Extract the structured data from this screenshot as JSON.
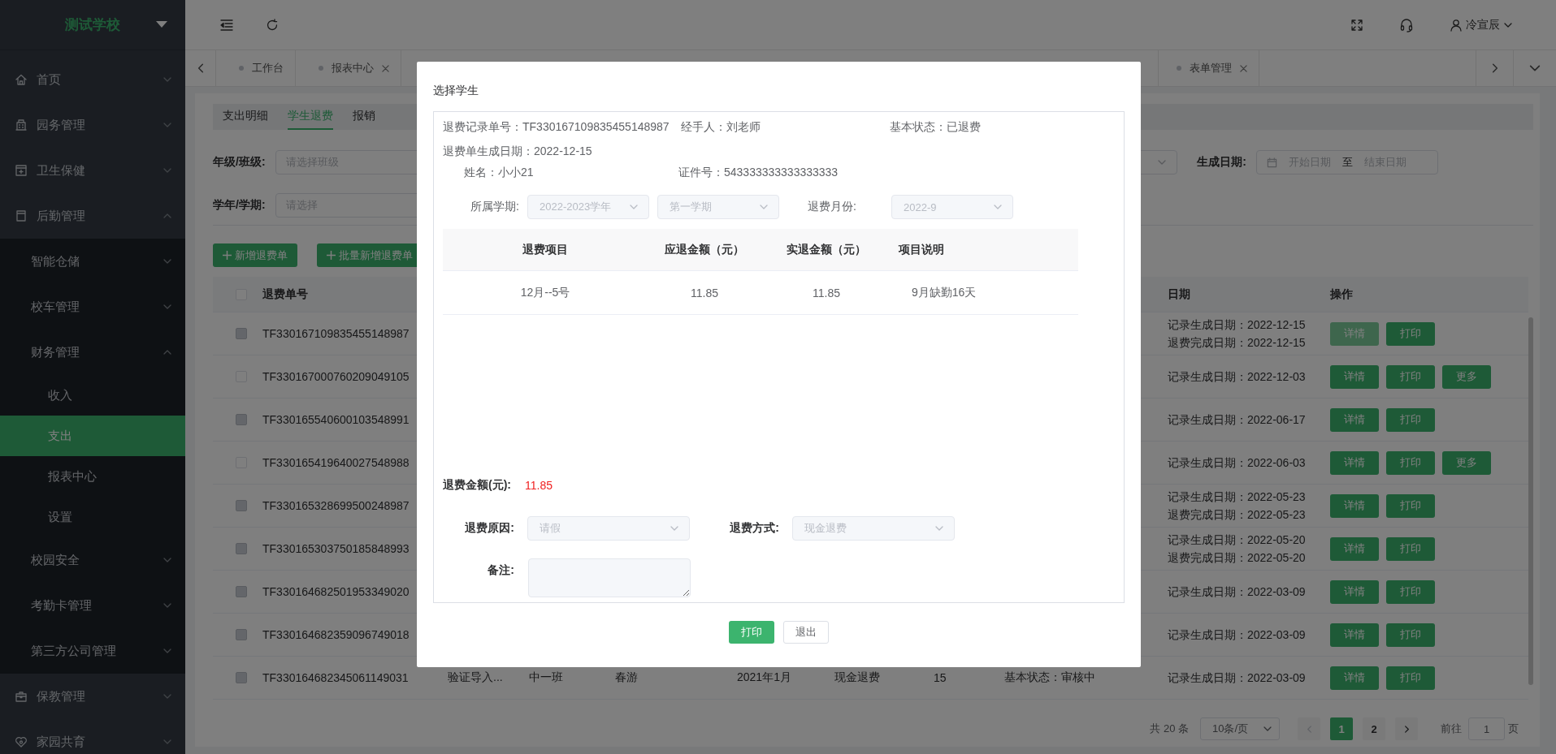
{
  "sidebar": {
    "logo": "测试学校",
    "items": [
      {
        "label": "首页",
        "expanded": false
      },
      {
        "label": "园务管理",
        "expanded": false
      },
      {
        "label": "卫生保健",
        "expanded": false
      },
      {
        "label": "后勤管理",
        "expanded": true,
        "children": [
          {
            "label": "智能仓储",
            "expanded": false
          },
          {
            "label": "校车管理",
            "expanded": false
          },
          {
            "label": "财务管理",
            "expanded": true,
            "children": [
              {
                "label": "收入",
                "selected": false
              },
              {
                "label": "支出",
                "selected": true
              },
              {
                "label": "报表中心",
                "selected": false
              },
              {
                "label": "设置",
                "selected": false
              }
            ]
          },
          {
            "label": "校园安全",
            "expanded": false
          },
          {
            "label": "考勤卡管理",
            "expanded": false
          },
          {
            "label": "第三方公司管理",
            "expanded": false
          }
        ]
      },
      {
        "label": "保教管理",
        "expanded": false
      },
      {
        "label": "家园共育",
        "expanded": false
      }
    ]
  },
  "header": {
    "user": "冷宣辰"
  },
  "page_tabs": [
    {
      "label": "工作台",
      "closable": false
    },
    {
      "label": "报表中心",
      "closable": true
    },
    {
      "label": "表单管理",
      "closable": true
    }
  ],
  "inner_tabs": [
    {
      "label": "支出明细",
      "selected": false
    },
    {
      "label": "学生退费",
      "selected": true
    },
    {
      "label": "报销",
      "selected": false
    }
  ],
  "filters": [
    {
      "label": "年级/班级:",
      "placeholder": "请选择班级"
    },
    {
      "label": "学年/学期:",
      "placeholder": "请选择"
    }
  ],
  "date_filter": {
    "label": "生成日期:",
    "start_placeholder": "开始日期",
    "separator": "至",
    "end_placeholder": "结束日期"
  },
  "actions": [
    "新增退费单",
    "批量新增退费单"
  ],
  "table": {
    "select_all": {
      "checked": false
    },
    "columns": [
      "退费单号",
      "日期",
      "操作"
    ],
    "rows": [
      {
        "disabled": true,
        "number": "TF330167109835455148987",
        "dates": [
          "记录生成日期：2022-12-15",
          "退费完成日期：2022-12-15"
        ],
        "actions": [
          {
            "label": "详情",
            "focused": true
          },
          {
            "label": "打印",
            "focused": false
          }
        ]
      },
      {
        "disabled": false,
        "number": "TF330167000760209049105",
        "dates": [
          "记录生成日期：2022-12-03"
        ],
        "actions": [
          {
            "label": "详情",
            "focused": false
          },
          {
            "label": "打印",
            "focused": false
          },
          {
            "label": "更多",
            "focused": false
          }
        ]
      },
      {
        "disabled": true,
        "number": "TF330165540600103548991",
        "dates": [
          "记录生成日期：2022-06-17"
        ],
        "actions": [
          {
            "label": "详情",
            "focused": false
          },
          {
            "label": "打印",
            "focused": false
          }
        ]
      },
      {
        "disabled": false,
        "number": "TF330165419640027548988",
        "dates": [
          "记录生成日期：2022-06-03"
        ],
        "actions": [
          {
            "label": "详情",
            "focused": false
          },
          {
            "label": "打印",
            "focused": false
          },
          {
            "label": "更多",
            "focused": false
          }
        ]
      },
      {
        "disabled": true,
        "number": "TF330165328699500248987",
        "dates": [
          "记录生成日期：2022-05-23",
          "退费完成日期：2022-05-23"
        ],
        "actions": [
          {
            "label": "详情",
            "focused": false
          },
          {
            "label": "打印",
            "focused": false
          }
        ]
      },
      {
        "disabled": true,
        "number": "TF330165303750185848993",
        "dates": [
          "记录生成日期：2022-05-20",
          "退费完成日期：2022-05-20"
        ],
        "actions": [
          {
            "label": "详情",
            "focused": false
          },
          {
            "label": "打印",
            "focused": false
          }
        ]
      },
      {
        "disabled": true,
        "number": "TF330164682501953349020",
        "dates": [
          "记录生成日期：2022-03-09"
        ],
        "actions": [
          {
            "label": "详情",
            "focused": false
          },
          {
            "label": "打印",
            "focused": false
          }
        ]
      },
      {
        "disabled": true,
        "number": "TF330164682359096749018",
        "dates": [
          "记录生成日期：2022-03-09"
        ],
        "actions": [
          {
            "label": "详情",
            "focused": false
          },
          {
            "label": "打印",
            "focused": false
          }
        ]
      },
      {
        "disabled": true,
        "number": "TF330164682345061149031",
        "cells": [
          "验证导入...",
          "中一班",
          "春游",
          "2021年1月",
          "现金退费",
          "15",
          "基本状态：审核中"
        ],
        "dates": [
          "记录生成日期：2022-03-09"
        ],
        "actions": [
          {
            "label": "详情",
            "focused": false
          },
          {
            "label": "打印",
            "focused": false
          }
        ]
      }
    ]
  },
  "pagination": {
    "total": "共 20 条",
    "page_size": "10条/页",
    "pages": [
      {
        "label": "1",
        "selected": true
      },
      {
        "label": "2",
        "selected": false
      }
    ],
    "goto_label": "前往",
    "goto_value": "1",
    "goto_suffix": "页"
  },
  "modal": {
    "title": "选择学生",
    "record_no": "退费记录单号：TF330167109835455148987",
    "handler": "经手人：刘老师",
    "status": "基本状态：已退费",
    "created": "退费单生成日期：2022-12-15",
    "name": "姓名：小小21",
    "id_no": "证件号：543333333333333333",
    "term_label": "所属学期:",
    "term_selects": [
      "2022-2023学年",
      "第一学期"
    ],
    "month_label": "退费月份:",
    "month_select": "2022-9",
    "table": {
      "columns": [
        "退费项目",
        "应退金额（元）",
        "实退金额（元）",
        "项目说明"
      ],
      "rows": [
        [
          "12月--5号",
          "11.85",
          "11.85",
          "9月缺勤16天"
        ]
      ]
    },
    "total_label": "退费金额(元):",
    "total": "11.85",
    "reason_label": "退费原因:",
    "reason": "请假",
    "method_label": "退费方式:",
    "method": "现金退费",
    "remark_label": "备注:",
    "buttons": [
      {
        "kind": "primary",
        "label": "打印"
      },
      {
        "kind": "default",
        "label": "退出"
      }
    ]
  }
}
